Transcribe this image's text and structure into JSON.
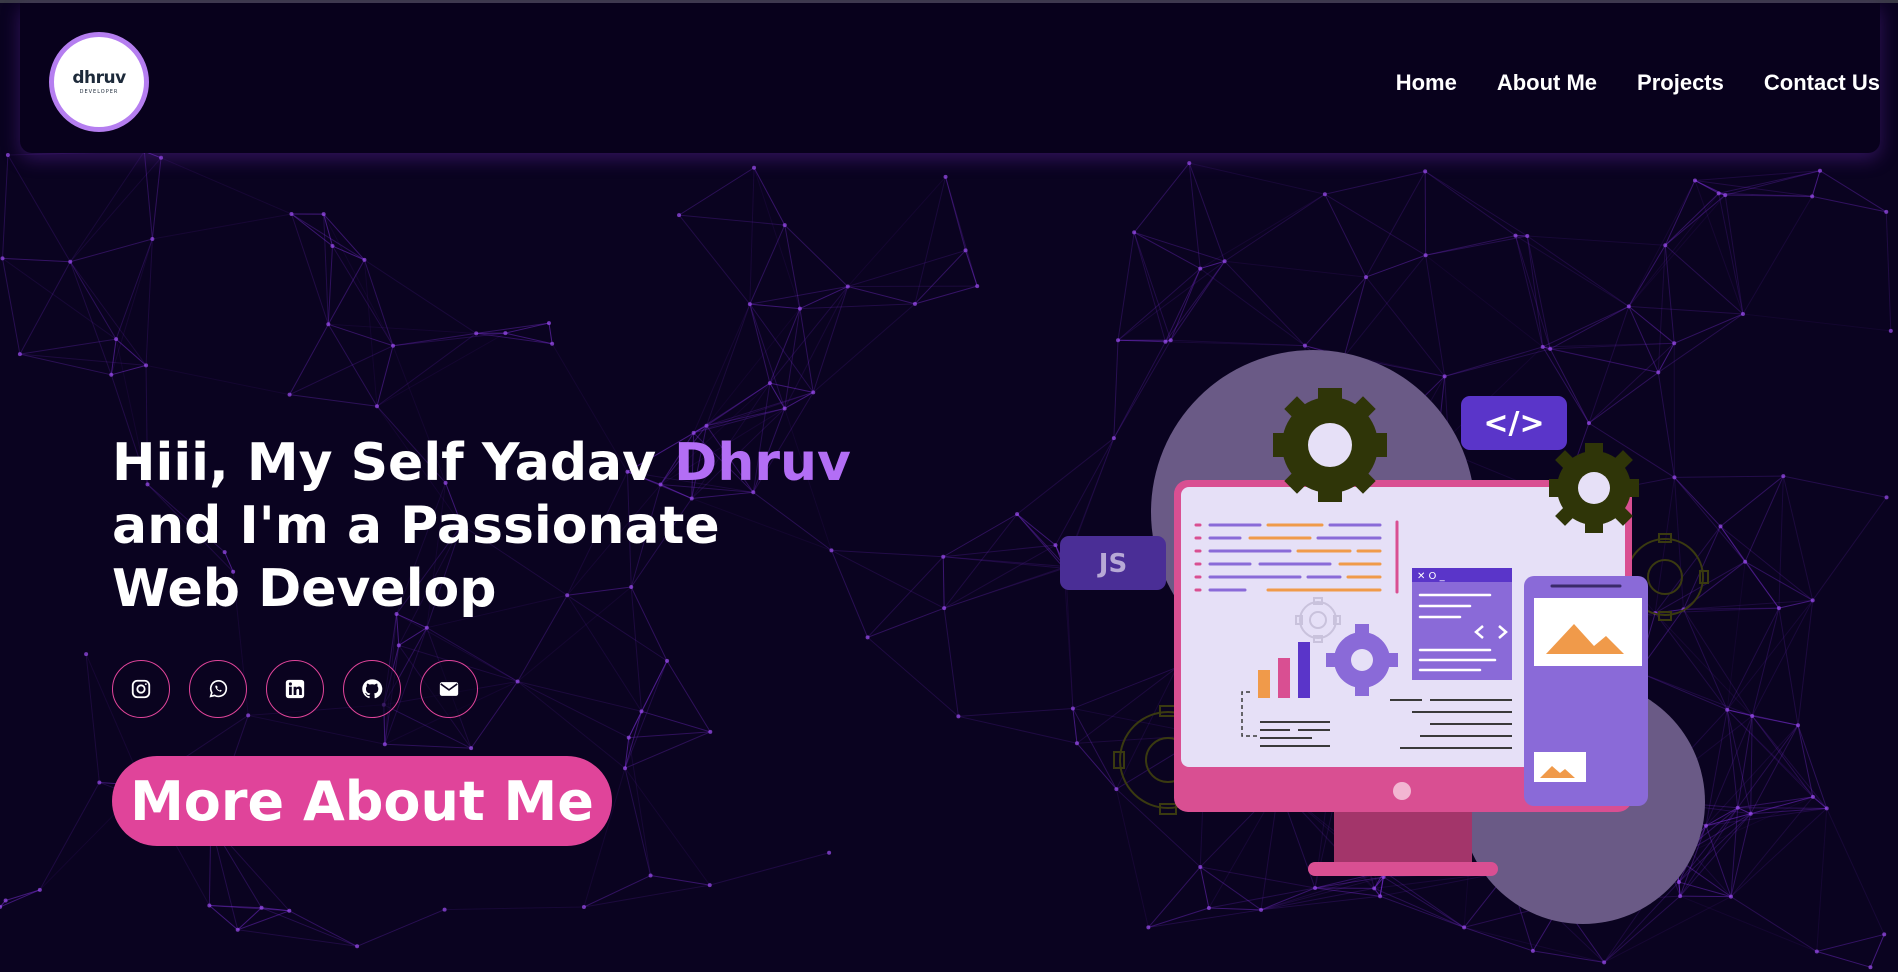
{
  "brand": {
    "logo_text": "dhruv",
    "logo_subtext": "DEVELOPER"
  },
  "nav": {
    "items": [
      {
        "label": "Home"
      },
      {
        "label": "About Me"
      },
      {
        "label": "Projects"
      },
      {
        "label": "Contact Us"
      }
    ]
  },
  "hero": {
    "line1_prefix": "Hiii, My Self Yadav ",
    "line1_name": "Dhruv",
    "line2": "and I'm a Passionate",
    "line3": "Web Develop",
    "cta_label": "More About Me"
  },
  "socials": [
    {
      "icon": "instagram-icon"
    },
    {
      "icon": "whatsapp-icon"
    },
    {
      "icon": "linkedin-icon"
    },
    {
      "icon": "github-icon"
    },
    {
      "icon": "envelope-icon"
    }
  ],
  "illustration": {
    "code_badge": "</>",
    "js_badge": "JS",
    "window_controls": "✕ O _"
  },
  "colors": {
    "background": "#0a0320",
    "accent_purple": "#b36ef5",
    "accent_pink": "#e0449a",
    "network_lines": "#7b2fd6"
  }
}
